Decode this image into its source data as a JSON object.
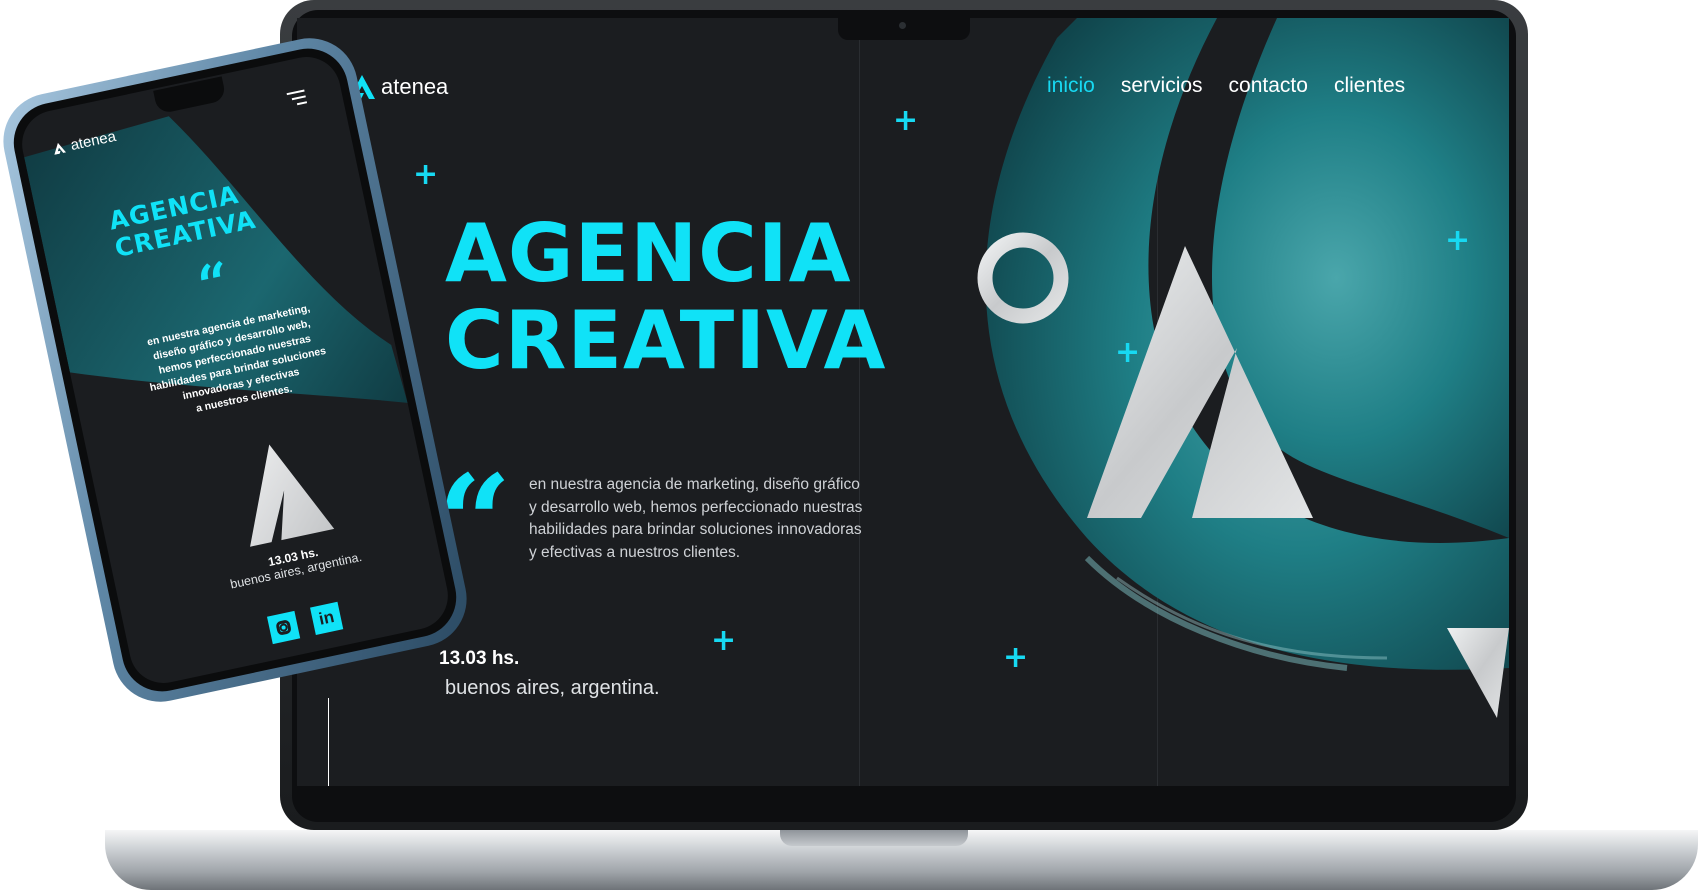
{
  "brand": {
    "name": "atenea"
  },
  "nav": {
    "items": [
      "inicio",
      "servicios",
      "contacto",
      "clientes"
    ],
    "active": "inicio"
  },
  "hero": {
    "headline_line1": "AGENCIA",
    "headline_line2": "CREATIVA",
    "quote_mark": "“",
    "description_lines": [
      "en nuestra agencia de marketing, diseño gráfico",
      "y desarrollo web, hemos perfeccionado nuestras",
      "habilidades  para brindar soluciones innovadoras",
      "y efectivas a nuestros clientes."
    ]
  },
  "status": {
    "time": "13.03 hs.",
    "location": "buenos aires, argentina."
  },
  "mobile": {
    "brand": "atenea",
    "headline_line1": "AGENCIA",
    "headline_line2": "CREATIVA",
    "quote_mark": "“",
    "description_lines": [
      "en nuestra agencia de marketing,",
      "diseño gráfico  y desarrollo web,",
      "hemos perfeccionado nuestras",
      "habilidades  para brindar soluciones",
      "innovadoras y efectivas",
      "a nuestros clientes."
    ],
    "time": "13.03 hs.",
    "location": "buenos aires, argentina.",
    "social": [
      "instagram-icon",
      "linkedin-icon"
    ],
    "linkedin_label": "in"
  },
  "colors": {
    "accent": "#10e2f7",
    "background": "#1b1d20",
    "ocean": "#1f7f86",
    "marble": "#d9dadb"
  }
}
